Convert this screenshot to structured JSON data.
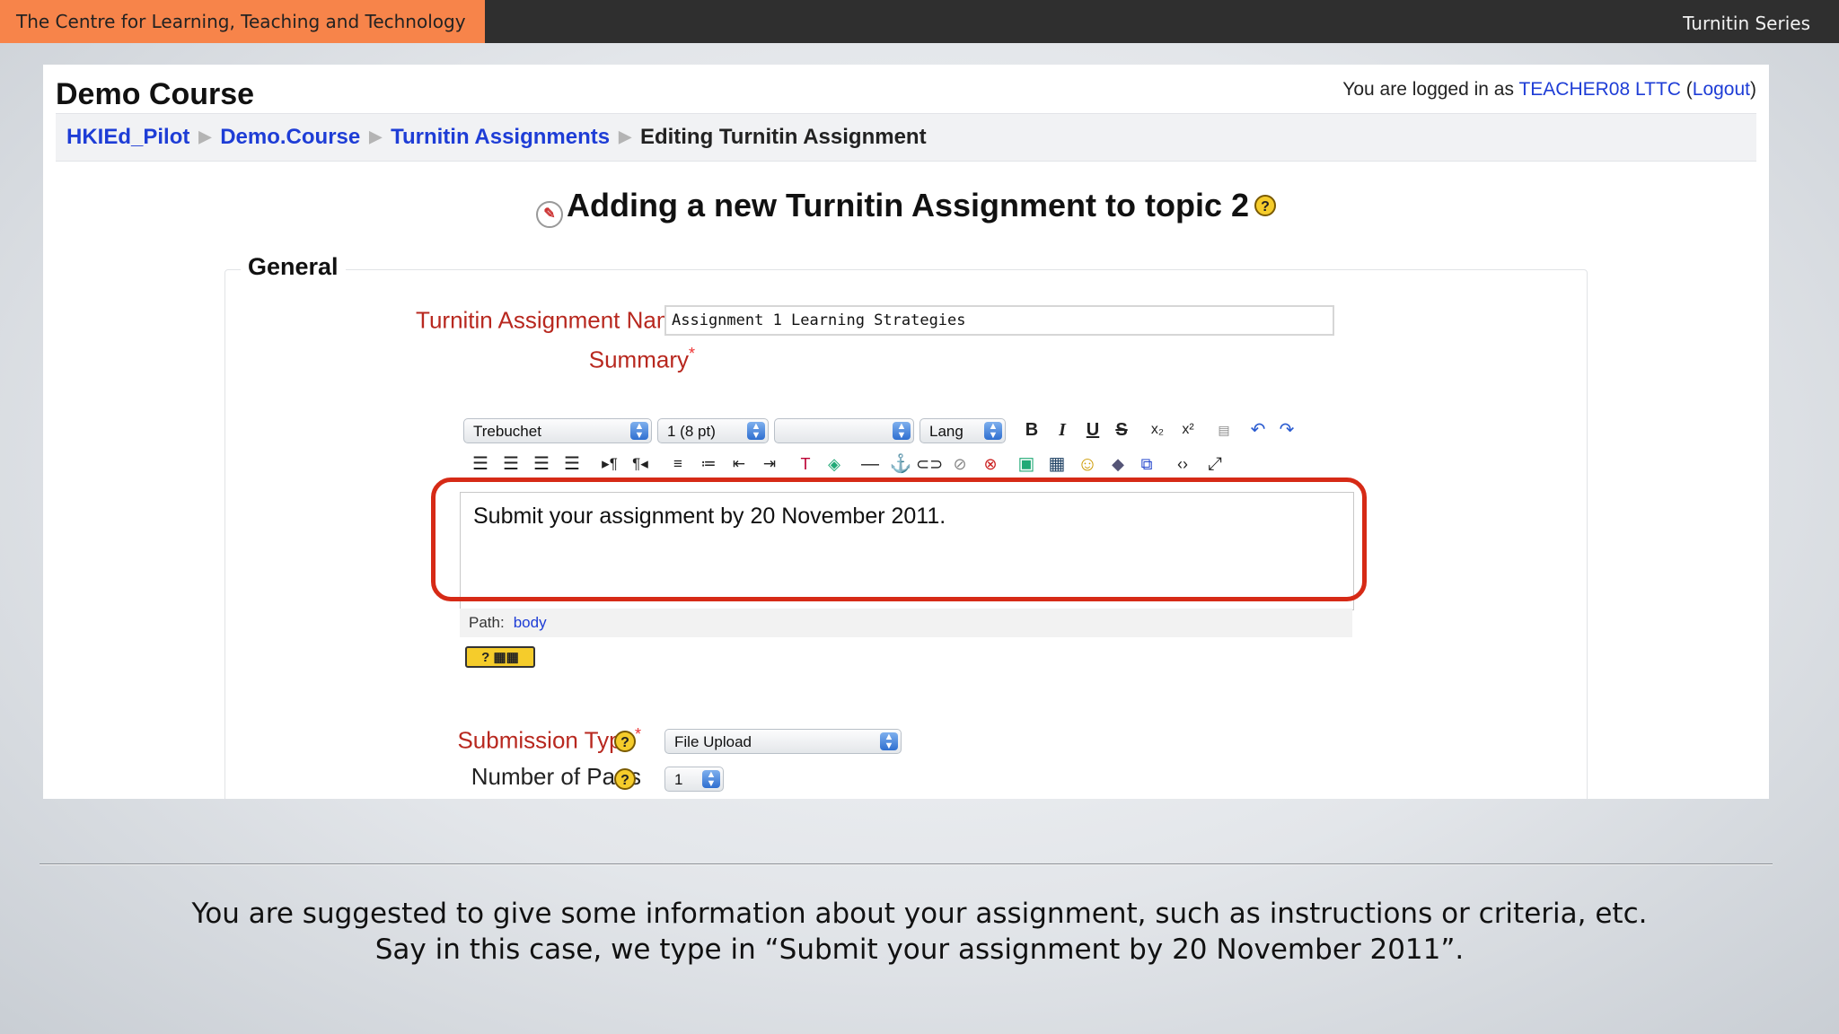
{
  "banner": {
    "left": "The Centre for Learning, Teaching and Technology",
    "right": "Turnitin Series"
  },
  "course": {
    "title": "Demo Course"
  },
  "login": {
    "prefix": "You are logged in as",
    "user": "TEACHER08 LTTC",
    "logout": "Logout"
  },
  "breadcrumb": {
    "items": [
      "HKIEd_Pilot",
      "Demo.Course",
      "Turnitin Assignments"
    ],
    "current": "Editing Turnitin Assignment",
    "separator": "▶"
  },
  "page": {
    "heading": "Adding a new Turnitin Assignment to topic 2"
  },
  "form": {
    "legend": "General",
    "name_label": "Turnitin Assignment Name",
    "name_value": "Assignment 1 Learning Strategies",
    "summary_label": "Summary",
    "required_mark": "*",
    "submission_type_label": "Submission Type",
    "submission_type_value": "File Upload",
    "parts_label": "Number of Parts",
    "parts_value": "1"
  },
  "editor": {
    "font": "Trebuchet",
    "size": "1 (8 pt)",
    "format": "",
    "lang": "Lang",
    "content": "Submit your assignment by 20 November 2011.",
    "path_label": "Path:",
    "path_value": "body"
  },
  "caption": {
    "line1": "You are suggested to give some information about your assignment, such as instructions or criteria, etc.",
    "line2": "Say in this case, we type in “Submit your assignment by 20 November 2011”."
  }
}
